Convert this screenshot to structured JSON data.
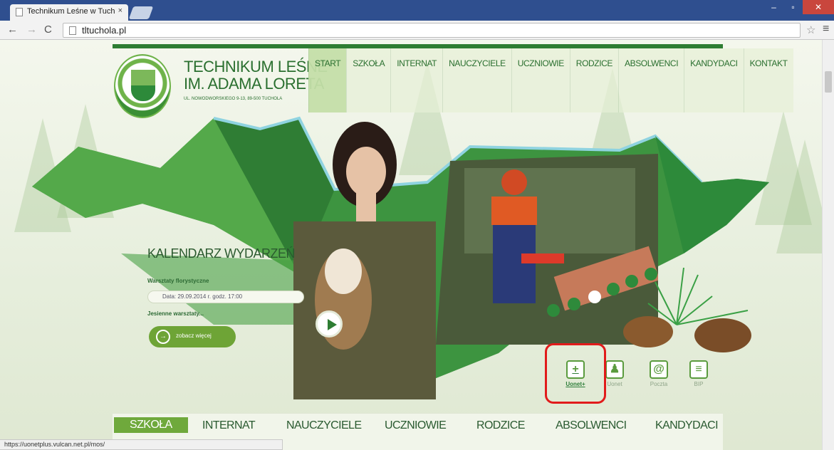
{
  "browser": {
    "tab_title": "Technikum Leśne w Tuch",
    "tab_close": "×",
    "url": "tltuchola.pl",
    "status_url": "https://uonetplus.vulcan.net.pl/mos/"
  },
  "site": {
    "name_line1": "TECHNIKUM LEŚNE",
    "name_line2": "IM. ADAMA LORETA",
    "address": "UL. NOWODWORSKIEGO 9-13, 89-500 TUCHOLA",
    "brand_green": "#2e7d33",
    "accent_green": "#6ea436"
  },
  "main_nav": [
    "START",
    "SZKOŁA",
    "INTERNAT",
    "NAUCZYCIELE",
    "UCZNIOWIE",
    "RODZICE",
    "ABSOLWENCI",
    "KANDYDACI",
    "KONTAKT"
  ],
  "calendar": {
    "title": "KALENDARZ WYDARZEŃ",
    "event_title": "Warsztaty florystyczne",
    "event_date": "Data: 29.09.2014 r. godz. 17:00",
    "event_desc": "Jesienne warsztaty...",
    "more_label": "zobacz więcej"
  },
  "quick_links": [
    {
      "label": "Uonet+",
      "icon": "plus-icon"
    },
    {
      "label": "Uonet",
      "icon": "person-icon"
    },
    {
      "label": "Poczta",
      "icon": "at-icon"
    },
    {
      "label": "BIP",
      "icon": "bip-icon"
    }
  ],
  "sub_nav": [
    "SZKOŁA",
    "INTERNAT",
    "NAUCZYCIELE",
    "UCZNIOWIE",
    "RODZICE",
    "ABSOLWENCI",
    "KANDYDACI"
  ],
  "highlight_color": "#e11b1b"
}
